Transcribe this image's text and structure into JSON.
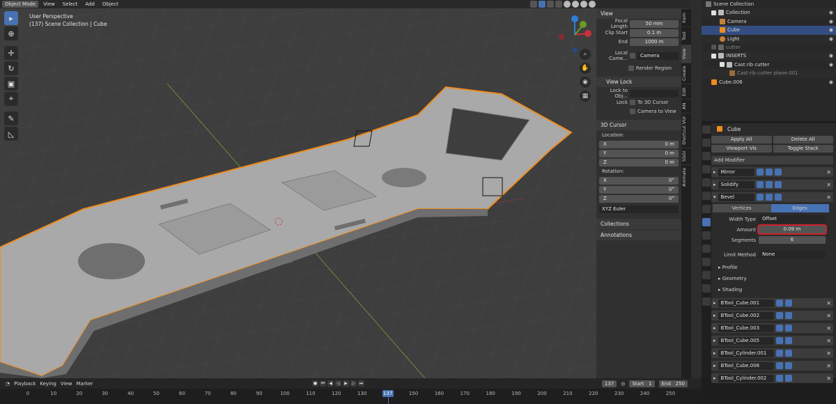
{
  "header": {
    "mode": "Object Mode",
    "menus": [
      "View",
      "Select",
      "Add",
      "Object"
    ]
  },
  "viewport": {
    "title_line1": "User Perspective",
    "title_line2": "(137) Scene Collection | Cube"
  },
  "npanel": {
    "view_section": "View",
    "focal_length_label": "Focal Length",
    "focal_length": "50 mm",
    "clip_start_label": "Clip Start",
    "clip_start": "0.1 m",
    "clip_end_label": "End",
    "clip_end": "1000 m",
    "local_camera_label": "Local Came...",
    "local_camera_value": "Camera",
    "render_region": "Render Region",
    "view_lock_section": "View Lock",
    "lock_to_object_label": "Lock to Obj...",
    "lock_label": "Lock",
    "to_3d_cursor": "To 3D Cursor",
    "camera_to_view": "Camera to View",
    "cursor_section": "3D Cursor",
    "location_label": "Location:",
    "loc_x_label": "X",
    "loc_x": "0 m",
    "loc_y_label": "Y",
    "loc_y": "0 m",
    "loc_z_label": "Z",
    "loc_z": "0 m",
    "rotation_label": "Rotation:",
    "rot_x_label": "X",
    "rot_x": "0°",
    "rot_y_label": "Y",
    "rot_y": "0°",
    "rot_z_label": "Z",
    "rot_z": "0°",
    "rotation_mode": "XYZ Euler",
    "collections_section": "Collections",
    "annotations_section": "Annotations"
  },
  "side_tabs": [
    "Item",
    "Tool",
    "View",
    "Create",
    "Edit",
    "AN",
    "Shortcut VUr",
    "SSGI",
    "Animate"
  ],
  "outliner": {
    "root": "Scene Collection",
    "rows": [
      {
        "label": "Collection",
        "indent": 1
      },
      {
        "label": "Camera",
        "indent": 2
      },
      {
        "label": "Cube",
        "indent": 2
      },
      {
        "label": "Light",
        "indent": 2
      },
      {
        "label": "cutter",
        "indent": 1
      },
      {
        "label": "INSERTS",
        "indent": 1
      },
      {
        "label": "Cast rib cutter",
        "indent": 2
      },
      {
        "label": "Cast rib cutter plane.001",
        "indent": 3
      },
      {
        "label": "Cube.006",
        "indent": 1
      }
    ]
  },
  "properties": {
    "object_name": "Cube",
    "apply_all": "Apply All",
    "delete_all": "Delete All",
    "viewport_vis": "Viewport Vis",
    "toggle_stack": "Toggle Stack",
    "add_modifier": "Add Modifier",
    "modifiers_top": [
      "Mirror",
      "Solidify",
      "Bevel"
    ],
    "bevel": {
      "vertices_tab": "Vertices",
      "edges_tab": "Edges",
      "width_type_label": "Width Type",
      "width_type": "Offset",
      "amount_label": "Amount",
      "amount": "0.09 m",
      "segments_label": "Segments",
      "segments": "6",
      "limit_method_label": "Limit Method",
      "limit_method": "None",
      "profile": "Profile",
      "geometry": "Geometry",
      "shading": "Shading"
    },
    "modifiers_bottom": [
      "BTool_Cube.001",
      "BTool_Cube.002",
      "BTool_Cube.003",
      "BTool_Cube.005",
      "BTool_Cylinder.001",
      "BTool_Cube.006",
      "BTool_Cylinder.002"
    ]
  },
  "timeline": {
    "menus": [
      "Playback",
      "Keying",
      "View",
      "Marker"
    ],
    "current_frame": "137",
    "start_label": "Start",
    "start": "1",
    "end_label": "End",
    "end": "250",
    "ticks": [
      "0",
      "10",
      "20",
      "30",
      "40",
      "50",
      "60",
      "70",
      "80",
      "90",
      "100",
      "110",
      "120",
      "130",
      "137",
      "150",
      "160",
      "170",
      "180",
      "190",
      "200",
      "210",
      "220",
      "230",
      "240",
      "250"
    ]
  },
  "colors": {
    "accent": "#4772b3",
    "selection_outline": "#f08c1e",
    "highlight_box": "#d0202a"
  }
}
